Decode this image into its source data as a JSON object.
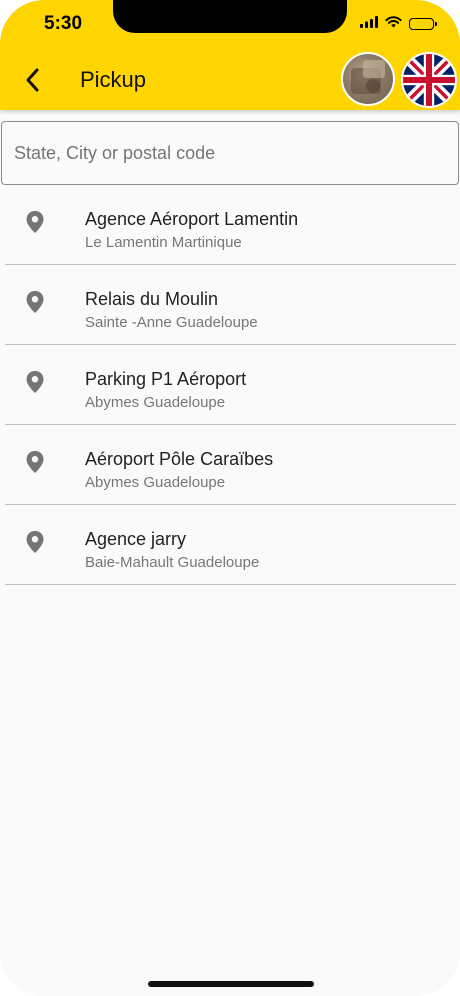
{
  "status_bar": {
    "time": "5:30"
  },
  "header": {
    "title": "Pickup",
    "back_icon": "chevron-left-icon",
    "background_color": "#ffd500"
  },
  "search": {
    "placeholder": "State, City or postal code",
    "value": ""
  },
  "locations": [
    {
      "name": "Agence Aéroport Lamentin",
      "address": "Le Lamentin Martinique"
    },
    {
      "name": "Relais du Moulin",
      "address": "Sainte -Anne Guadeloupe"
    },
    {
      "name": "Parking P1 Aéroport",
      "address": "Abymes Guadeloupe"
    },
    {
      "name": "Aéroport Pôle Caraïbes",
      "address": "Abymes Guadeloupe"
    },
    {
      "name": "Agence jarry",
      "address": "Baie-Mahault Guadeloupe"
    }
  ],
  "icons": {
    "location": "location-pin-icon",
    "language": "uk-flag-icon",
    "profile": "avatar"
  }
}
